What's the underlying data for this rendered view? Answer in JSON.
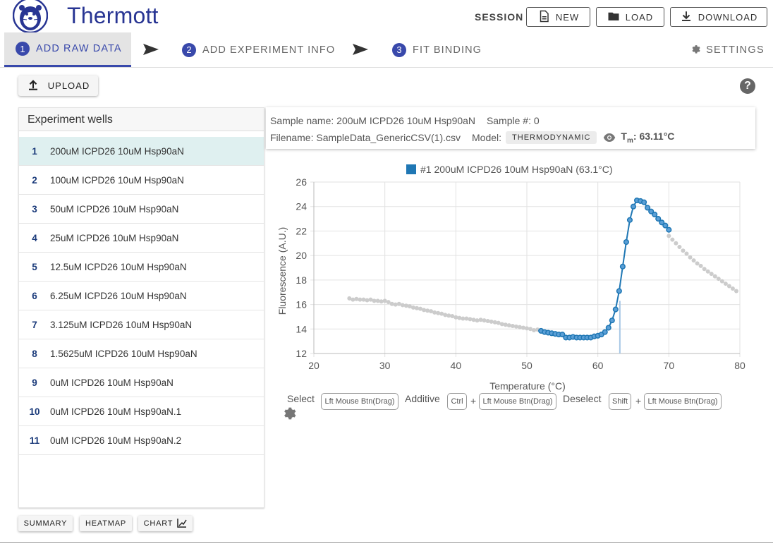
{
  "header": {
    "app_title": "Thermott",
    "session_label": "SESSION",
    "new_label": "NEW",
    "load_label": "LOAD",
    "download_label": "DOWNLOAD"
  },
  "stepper": {
    "steps": [
      {
        "num": "1",
        "label": "ADD RAW DATA"
      },
      {
        "num": "2",
        "label": "ADD EXPERIMENT INFO"
      },
      {
        "num": "3",
        "label": "FIT BINDING"
      }
    ],
    "settings_label": "SETTINGS"
  },
  "toolbar": {
    "upload_label": "UPLOAD"
  },
  "wells": {
    "title": "Experiment wells",
    "items": [
      {
        "num": "1",
        "label": "200uM ICPD26 10uM Hsp90aN"
      },
      {
        "num": "2",
        "label": "100uM ICPD26 10uM Hsp90aN"
      },
      {
        "num": "3",
        "label": "50uM ICPD26 10uM Hsp90aN"
      },
      {
        "num": "4",
        "label": "25uM ICPD26 10uM Hsp90aN"
      },
      {
        "num": "5",
        "label": "12.5uM ICPD26 10uM Hsp90aN"
      },
      {
        "num": "6",
        "label": "6.25uM ICPD26 10uM Hsp90aN"
      },
      {
        "num": "7",
        "label": "3.125uM ICPD26 10uM Hsp90aN"
      },
      {
        "num": "8",
        "label": "1.5625uM ICPD26 10uM Hsp90aN"
      },
      {
        "num": "9",
        "label": "0uM ICPD26 10uM Hsp90aN"
      },
      {
        "num": "10",
        "label": "0uM ICPD26 10uM Hsp90aN.1"
      },
      {
        "num": "11",
        "label": "0uM ICPD26 10uM Hsp90aN.2"
      }
    ],
    "selected": "1",
    "summary_label": "SUMMARY",
    "heatmap_label": "HEATMAP",
    "chart_label": "CHART"
  },
  "info": {
    "sample_name": "Sample name: 200uM ICPD26 10uM Hsp90aN",
    "sample_num": "Sample #: 0",
    "filename": "Filename: SampleData_GenericCSV(1).csv",
    "model_label": "Model:",
    "model_value": "THERMODYNAMIC",
    "tm_label": "T",
    "tm_sub": "m",
    "tm_value": ": 63.11°C"
  },
  "chart_data": {
    "type": "scatter",
    "title": "#1 200uM ICPD26 10uM Hsp90aN (63.1°C)",
    "xlabel": "Temperature (°C)",
    "ylabel": "Fluorescence (A.U.)",
    "xlim": [
      20,
      80
    ],
    "ylim": [
      12,
      26
    ],
    "xticks": [
      20,
      30,
      40,
      50,
      60,
      70,
      80
    ],
    "yticks": [
      12,
      14,
      16,
      18,
      20,
      22,
      24,
      26
    ],
    "grid": true,
    "tm_marker": 63.1,
    "series_color": "#1f77b4",
    "excluded_color": "#cccccc",
    "excluded": [
      [
        25,
        16.5
      ],
      [
        25.5,
        16.4
      ],
      [
        26,
        16.45
      ],
      [
        26.5,
        16.4
      ],
      [
        27,
        16.4
      ],
      [
        27.5,
        16.35
      ],
      [
        28,
        16.4
      ],
      [
        28.5,
        16.3
      ],
      [
        29,
        16.3
      ],
      [
        29.5,
        16.25
      ],
      [
        30,
        16.3
      ],
      [
        30.5,
        16.2
      ],
      [
        31,
        16.05
      ],
      [
        31.5,
        16.0
      ],
      [
        32,
        16.05
      ],
      [
        32.5,
        15.95
      ],
      [
        33,
        15.9
      ],
      [
        33.5,
        15.85
      ],
      [
        34,
        15.75
      ],
      [
        34.5,
        15.7
      ],
      [
        35,
        15.65
      ],
      [
        35.5,
        15.55
      ],
      [
        36,
        15.5
      ],
      [
        36.5,
        15.45
      ],
      [
        37,
        15.35
      ],
      [
        37.5,
        15.3
      ],
      [
        38,
        15.25
      ],
      [
        38.5,
        15.15
      ],
      [
        39,
        15.1
      ],
      [
        39.5,
        15.05
      ],
      [
        40,
        14.95
      ],
      [
        40.5,
        14.9
      ],
      [
        41,
        14.85
      ],
      [
        41.5,
        14.85
      ],
      [
        42,
        14.8
      ],
      [
        42.5,
        14.75
      ],
      [
        43,
        14.7
      ],
      [
        43.5,
        14.75
      ],
      [
        44,
        14.7
      ],
      [
        44.5,
        14.65
      ],
      [
        45,
        14.6
      ],
      [
        45.5,
        14.55
      ],
      [
        46,
        14.5
      ],
      [
        46.5,
        14.4
      ],
      [
        47,
        14.35
      ],
      [
        47.5,
        14.3
      ],
      [
        48,
        14.25
      ],
      [
        48.5,
        14.2
      ],
      [
        49,
        14.15
      ],
      [
        49.5,
        14.1
      ],
      [
        50,
        14.05
      ],
      [
        50.5,
        14.0
      ],
      [
        51,
        13.9
      ],
      [
        51.5,
        13.95
      ],
      [
        70,
        21.6
      ],
      [
        70.5,
        21.3
      ],
      [
        71,
        21.0
      ],
      [
        71.5,
        20.7
      ],
      [
        72,
        20.4
      ],
      [
        72.5,
        20.15
      ],
      [
        73,
        19.85
      ],
      [
        73.5,
        19.6
      ],
      [
        74,
        19.35
      ],
      [
        74.5,
        19.15
      ],
      [
        75,
        18.9
      ],
      [
        75.5,
        18.7
      ],
      [
        76,
        18.5
      ],
      [
        76.5,
        18.3
      ],
      [
        77,
        18.1
      ],
      [
        77.5,
        17.9
      ],
      [
        78,
        17.7
      ],
      [
        78.5,
        17.5
      ],
      [
        79,
        17.3
      ],
      [
        79.5,
        17.1
      ]
    ],
    "selected": [
      [
        52,
        13.85
      ],
      [
        52.5,
        13.75
      ],
      [
        53,
        13.7
      ],
      [
        53.5,
        13.65
      ],
      [
        54,
        13.6
      ],
      [
        54.5,
        13.55
      ],
      [
        55,
        13.55
      ],
      [
        55.5,
        13.3
      ],
      [
        56,
        13.3
      ],
      [
        56.5,
        13.35
      ],
      [
        57,
        13.3
      ],
      [
        57.5,
        13.3
      ],
      [
        58,
        13.3
      ],
      [
        58.5,
        13.3
      ],
      [
        59,
        13.3
      ],
      [
        59.5,
        13.4
      ],
      [
        60,
        13.45
      ],
      [
        60.5,
        13.55
      ],
      [
        61,
        13.75
      ],
      [
        61.5,
        14.1
      ],
      [
        62,
        14.7
      ],
      [
        62.5,
        15.6
      ],
      [
        63,
        17.1
      ],
      [
        63.5,
        19.1
      ],
      [
        64,
        21.1
      ],
      [
        64.5,
        22.9
      ],
      [
        65,
        24.0
      ],
      [
        65.5,
        24.5
      ],
      [
        66,
        24.45
      ],
      [
        66.5,
        24.35
      ],
      [
        67,
        23.9
      ],
      [
        67.5,
        23.6
      ],
      [
        68,
        23.35
      ],
      [
        68.5,
        23.0
      ],
      [
        69,
        22.7
      ],
      [
        69.5,
        22.45
      ],
      [
        70,
        22.1
      ]
    ]
  },
  "instructions": {
    "select": "Select",
    "lft": "Lft Mouse Btn(Drag)",
    "additive": "Additive",
    "ctrl": "Ctrl",
    "plus": "+",
    "deselect": "Deselect",
    "shift": "Shift"
  }
}
